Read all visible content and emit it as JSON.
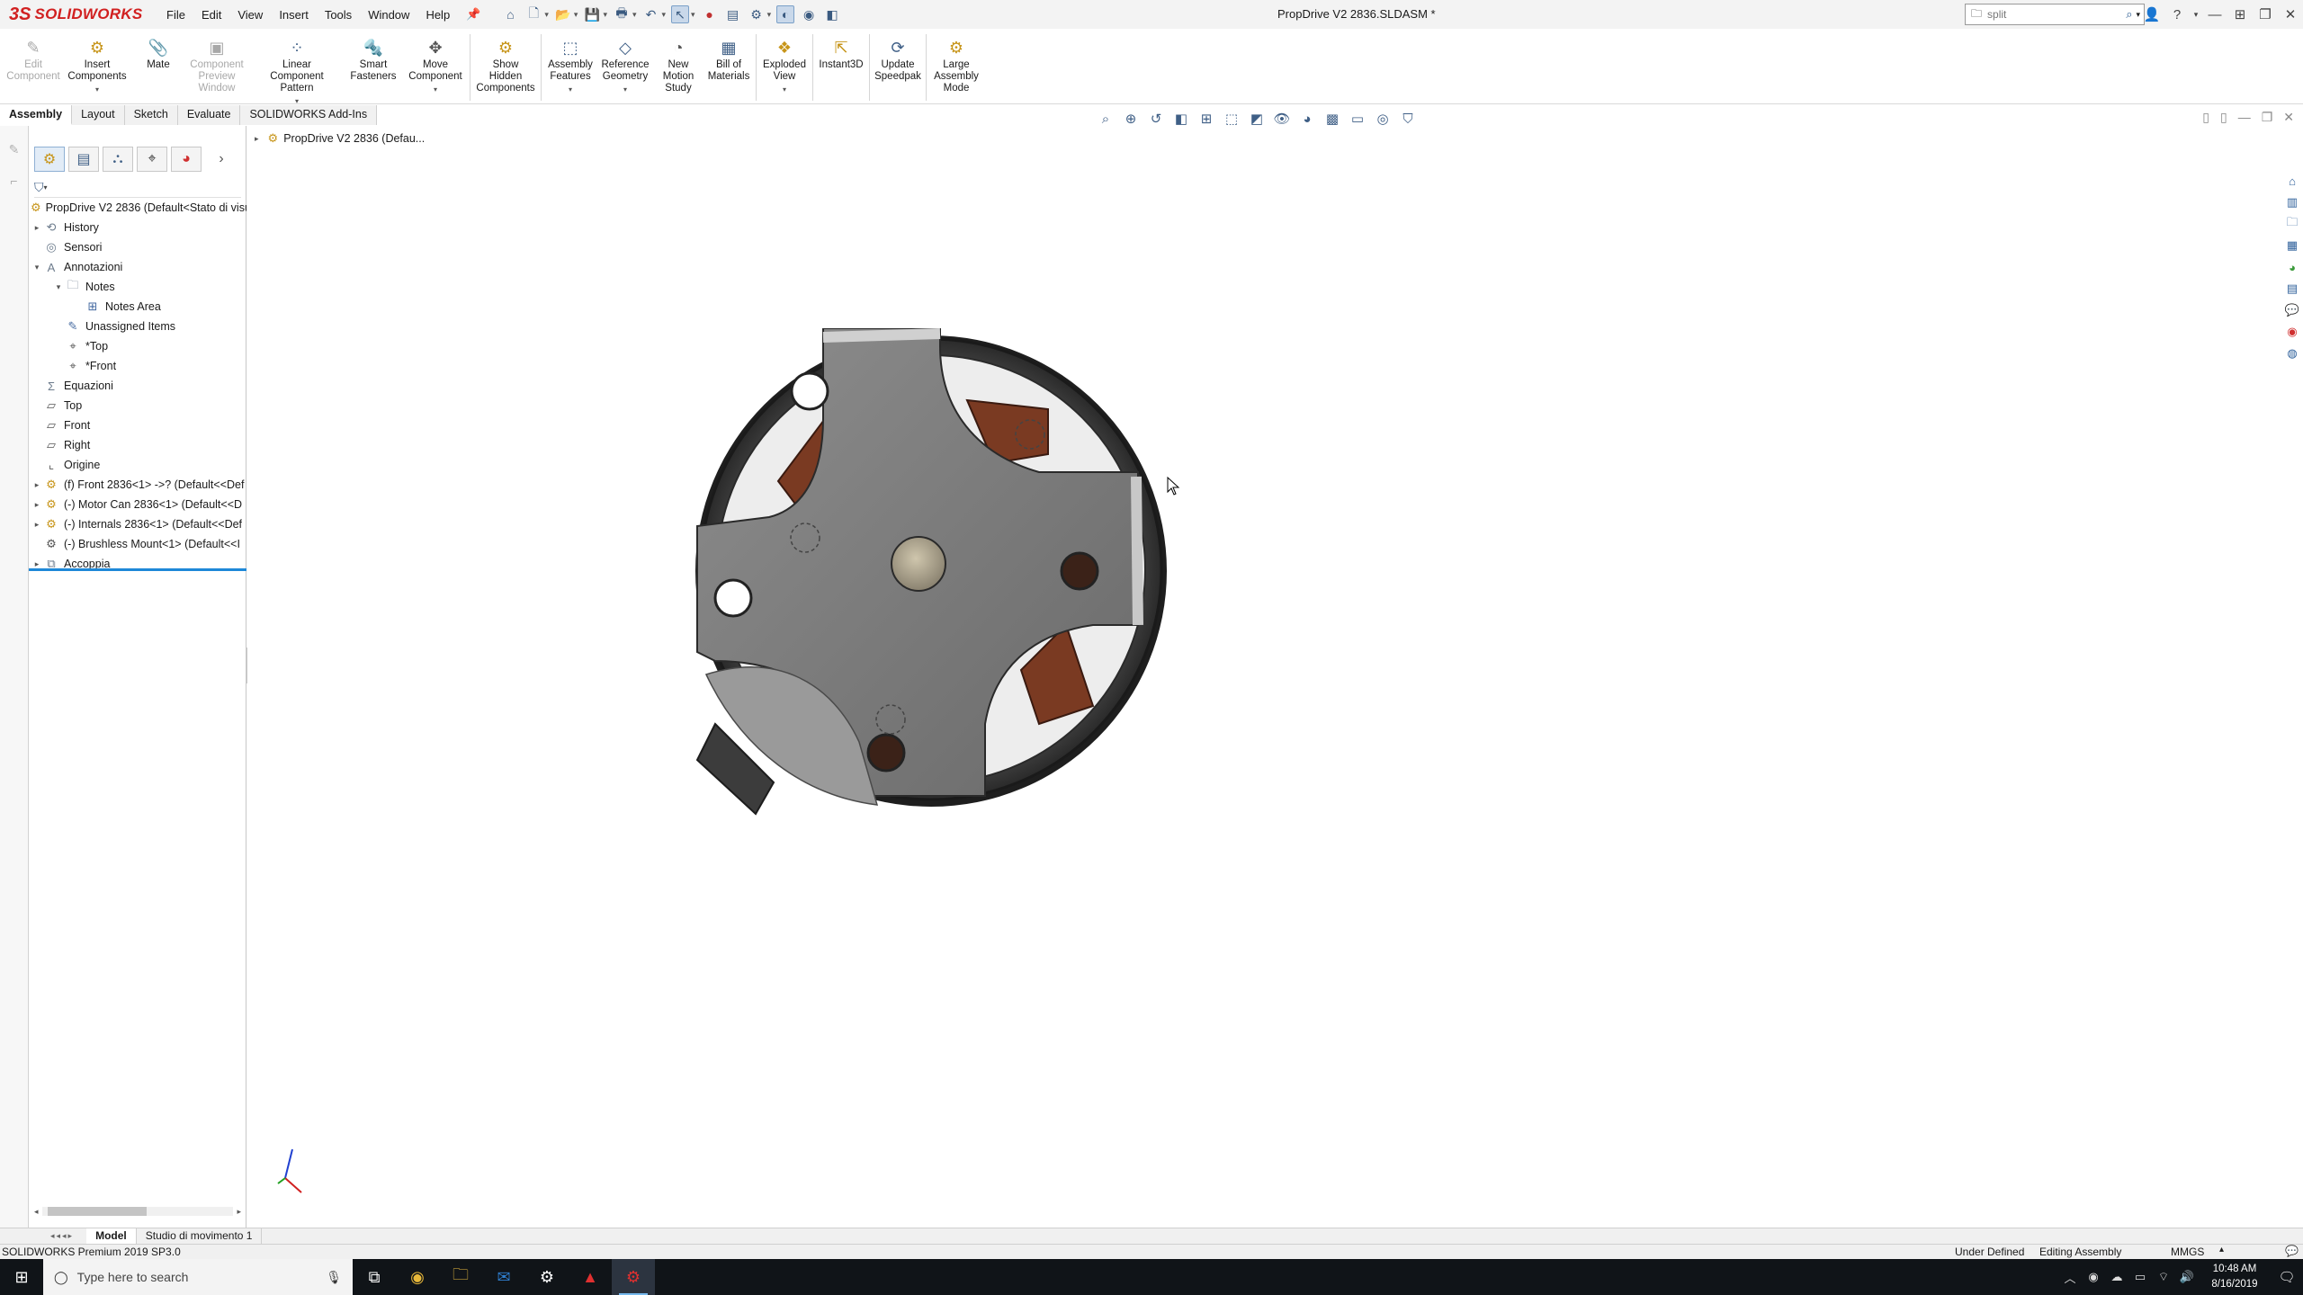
{
  "app": {
    "brand_ds": "3S",
    "brand_name": "SOLIDWORKS",
    "document_title": "PropDrive V2 2836.SLDASM *"
  },
  "menu": [
    "File",
    "Edit",
    "View",
    "Insert",
    "Tools",
    "Window",
    "Help"
  ],
  "search": {
    "value": "split"
  },
  "commands": [
    {
      "label": "Edit Component",
      "icon": "edit-component-icon",
      "enabled": false
    },
    {
      "label": "Insert Components",
      "icon": "insert-components-icon",
      "enabled": true
    },
    {
      "label": "Mate",
      "icon": "mate-icon",
      "enabled": true
    },
    {
      "label": "Component Preview Window",
      "icon": "component-preview-icon",
      "enabled": false
    },
    {
      "label": "Linear Component Pattern",
      "icon": "linear-pattern-icon",
      "enabled": true
    },
    {
      "label": "Smart Fasteners",
      "icon": "smart-fasteners-icon",
      "enabled": true
    },
    {
      "label": "Move Component",
      "icon": "move-component-icon",
      "enabled": true
    },
    {
      "label": "Show Hidden Components",
      "icon": "show-hidden-icon",
      "enabled": true
    },
    {
      "label": "Assembly Features",
      "icon": "assembly-features-icon",
      "enabled": true
    },
    {
      "label": "Reference Geometry",
      "icon": "reference-geometry-icon",
      "enabled": true
    },
    {
      "label": "New Motion Study",
      "icon": "motion-study-icon",
      "enabled": true
    },
    {
      "label": "Bill of Materials",
      "icon": "bom-icon",
      "enabled": true
    },
    {
      "label": "Exploded View",
      "icon": "exploded-view-icon",
      "enabled": true
    },
    {
      "label": "Instant3D",
      "icon": "instant3d-icon",
      "enabled": true
    },
    {
      "label": "Update Speedpak",
      "icon": "speedpak-icon",
      "enabled": true
    },
    {
      "label": "Large Assembly Mode",
      "icon": "large-assembly-icon",
      "enabled": true
    }
  ],
  "command_tabs": [
    "Assembly",
    "Layout",
    "Sketch",
    "Evaluate",
    "SOLIDWORKS Add-Ins"
  ],
  "feature_tree": [
    {
      "label": "PropDrive V2 2836  (Default<Stato di visu",
      "icon": "assembly-icon"
    },
    {
      "label": "History",
      "icon": "history-icon"
    },
    {
      "label": "Sensori",
      "icon": "sensors-icon"
    },
    {
      "label": "Annotazioni",
      "icon": "annotations-icon"
    },
    {
      "label": "Notes",
      "icon": "notes-folder-icon"
    },
    {
      "label": "Notes Area",
      "icon": "notes-area-icon"
    },
    {
      "label": "Unassigned Items",
      "icon": "unassigned-items-icon"
    },
    {
      "label": "*Top",
      "icon": "annotation-view-icon"
    },
    {
      "label": "*Front",
      "icon": "annotation-view-icon"
    },
    {
      "label": "Equazioni",
      "icon": "equations-icon"
    },
    {
      "label": "Top",
      "icon": "plane-icon"
    },
    {
      "label": "Front",
      "icon": "plane-icon"
    },
    {
      "label": "Right",
      "icon": "plane-icon"
    },
    {
      "label": "Origine",
      "icon": "origin-icon"
    },
    {
      "label": "(f) Front 2836<1> ->? (Default<<Def",
      "icon": "part-icon"
    },
    {
      "label": "(-) Motor Can 2836<1> (Default<<D",
      "icon": "part-icon"
    },
    {
      "label": "(-) Internals 2836<1> (Default<<Def",
      "icon": "part-icon"
    },
    {
      "label": "(-) Brushless Mount<1> (Default<<I",
      "icon": "part-icon"
    },
    {
      "label": "Accoppia",
      "icon": "mates-icon"
    }
  ],
  "flyout_tree": {
    "label": "PropDrive V2 2836  (Defau..."
  },
  "bottom_tabs": [
    "Model",
    "Studio di movimento 1"
  ],
  "status": {
    "product": "SOLIDWORKS Premium 2019 SP3.0",
    "definition": "Under Defined",
    "mode": "Editing Assembly",
    "units": "MMGS"
  },
  "taskbar": {
    "search_placeholder": "Type here to search",
    "time": "10:48 AM",
    "date": "8/16/2019"
  },
  "colors": {
    "brand_red": "#d12020",
    "selection_blue": "#1e88d8",
    "taskbar": "#101418"
  }
}
